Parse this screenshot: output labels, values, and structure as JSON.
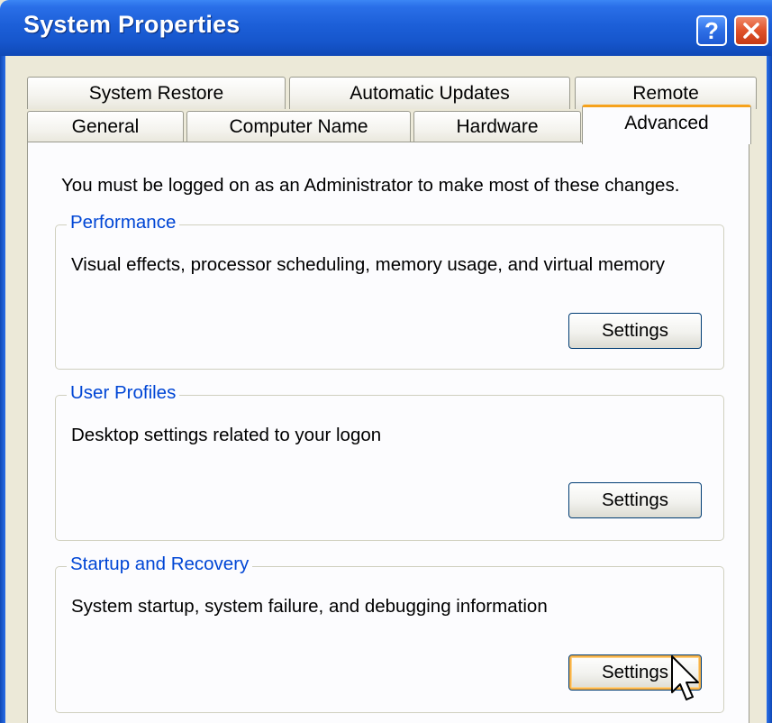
{
  "window": {
    "title": "System Properties",
    "help_label": "?",
    "close_icon": "close-icon"
  },
  "tabs": {
    "row_back": [
      "System Restore",
      "Automatic Updates",
      "Remote"
    ],
    "row_front": [
      "General",
      "Computer Name",
      "Hardware",
      "Advanced"
    ],
    "active": "Advanced"
  },
  "panel": {
    "admin_note": "You must be logged on as an Administrator to make most of these changes."
  },
  "groups": {
    "performance": {
      "title": "Performance",
      "description": "Visual effects, processor scheduling, memory usage, and virtual memory",
      "button_label": "Settings"
    },
    "user_profiles": {
      "title": "User Profiles",
      "description": "Desktop settings related to your logon",
      "button_label": "Settings"
    },
    "startup_recovery": {
      "title": "Startup and Recovery",
      "description": "System startup, system failure, and debugging information",
      "button_label": "Settings"
    }
  },
  "colors": {
    "titlebar": "#1c5fd8",
    "group_title": "#0046d5",
    "active_tab_accent": "#f6a21c",
    "window_bg": "#ece9d8"
  }
}
